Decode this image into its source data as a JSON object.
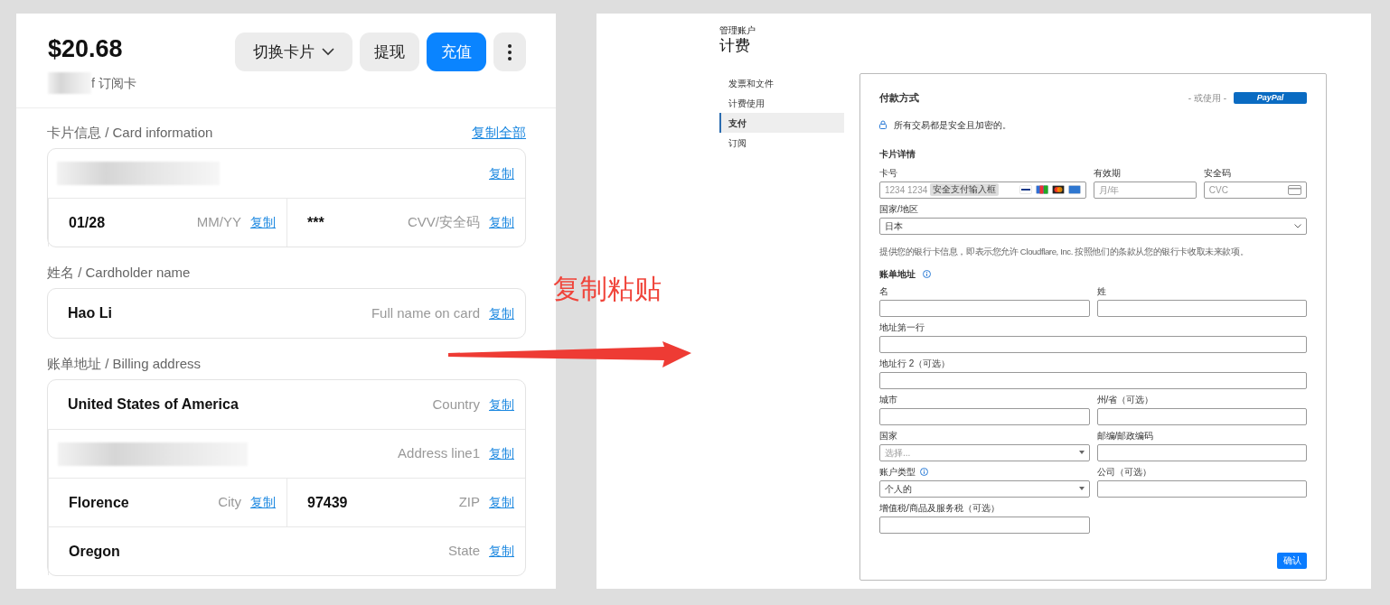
{
  "wallet": {
    "balance": "$20.68",
    "subtitle": {
      "text": "f 订阅卡",
      "redacted": true
    },
    "buttons": [
      {
        "label": "切换卡片",
        "kind": "dropdown"
      },
      {
        "label": "提现",
        "kind": "secondary"
      },
      {
        "label": "充值",
        "kind": "primary"
      },
      {
        "kind": "more"
      }
    ],
    "sections": [
      {
        "title": "卡片信息 / Card information",
        "action": "复制全部",
        "rows": [
          [
            {
              "redacted": true,
              "copy": "复制",
              "colspan": 2
            }
          ],
          [
            {
              "value": "01/28",
              "hint": "MM/YY",
              "copy": "复制"
            },
            {
              "value": "***",
              "hint": "CVV/安全码",
              "copy": "复制"
            }
          ]
        ]
      },
      {
        "title": "姓名 / Cardholder name",
        "rows": [
          [
            {
              "value": "Hao Li",
              "hint": "Full name on card",
              "copy": "复制",
              "colspan": 2
            }
          ]
        ]
      },
      {
        "title": "账单地址 / Billing address",
        "rows": [
          [
            {
              "value": "United States of America",
              "hint": "Country",
              "copy": "复制",
              "colspan": 2
            }
          ],
          [
            {
              "redacted": true,
              "hint": "Address line1",
              "copy": "复制",
              "colspan": 2
            }
          ],
          [
            {
              "value": "Florence",
              "hint": "City",
              "copy": "复制"
            },
            {
              "value": "97439",
              "hint": "ZIP",
              "copy": "复制"
            }
          ],
          [
            {
              "value": "Oregon",
              "hint": "State",
              "copy": "复制",
              "colspan": 2
            }
          ]
        ]
      }
    ]
  },
  "annotation": {
    "text": "复制粘贴"
  },
  "billing": {
    "breadcrumb": "管理账户",
    "title": "计费",
    "nav": [
      {
        "label": "发票和文件",
        "selected": false
      },
      {
        "label": "计费使用",
        "selected": false
      },
      {
        "label": "支付",
        "selected": true
      },
      {
        "label": "订阅",
        "selected": false
      }
    ],
    "card": {
      "title": "付款方式",
      "alt_text": "- 或使用 -",
      "paypal": "PayPal",
      "secure_note": "所有交易都是安全且加密的。",
      "details_title": "卡片详情",
      "detail_fields": [
        {
          "label": "卡号",
          "placeholder": "1234 1234",
          "tooltip": "安全支付输入框",
          "kind": "card"
        },
        {
          "label": "有效期",
          "placeholder": "月/年",
          "kind": "text"
        },
        {
          "label": "安全码",
          "placeholder": "CVC",
          "kind": "cvc"
        }
      ],
      "region": {
        "label": "国家/地区",
        "value": "日本"
      },
      "consent": "提供您的银行卡信息，即表示您允许 Cloudflare, Inc. 按照他们的条款从您的银行卡收取未来款项。",
      "address_title": "账单地址",
      "address_rows": [
        [
          {
            "label": "名",
            "kind": "text"
          },
          {
            "label": "姓",
            "kind": "text"
          }
        ],
        [
          {
            "label": "地址第一行",
            "kind": "text"
          }
        ],
        [
          {
            "label": "地址行 2（可选）",
            "kind": "text"
          }
        ],
        [
          {
            "label": "城市",
            "kind": "text"
          },
          {
            "label": "州/省（可选）",
            "kind": "text"
          }
        ],
        [
          {
            "label": "国家",
            "kind": "select",
            "placeholder": "选择..."
          },
          {
            "label": "邮编/邮政编码",
            "kind": "text"
          }
        ],
        [
          {
            "label": "账户类型",
            "kind": "select",
            "value": "个人的",
            "info": true
          },
          {
            "label": "公司（可选）",
            "kind": "text"
          }
        ],
        [
          {
            "label": "增值税/商品及服务税（可选）",
            "kind": "text"
          }
        ]
      ],
      "submit": "确认"
    }
  }
}
